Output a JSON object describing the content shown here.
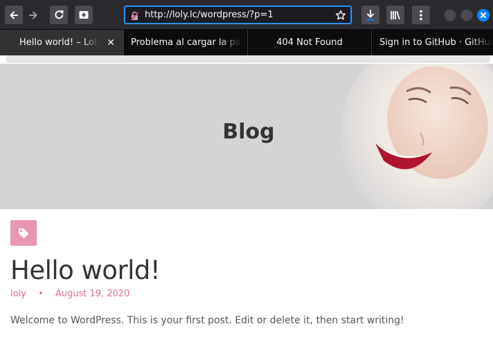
{
  "browser": {
    "url": "http://loly.lc/wordpress/?p=1",
    "tabs": [
      {
        "title": "Hello world! – Loly",
        "active": true
      },
      {
        "title": "Problema al cargar la página",
        "active": false
      },
      {
        "title": "404 Not Found",
        "active": false
      },
      {
        "title": "Sign in to GitHub · GitHub",
        "active": false
      }
    ],
    "icons": {
      "back": "arrow-left-icon",
      "forward": "arrow-right-icon",
      "reload": "reload-icon",
      "new_tab": "new-tab-icon",
      "lock": "insecure-lock-icon",
      "bookmark": "star-icon",
      "download": "download-icon",
      "library": "library-icon",
      "menu": "kebab-menu-icon",
      "close_tab": "close-icon"
    },
    "colors": {
      "chrome": "#2a2a2e",
      "url_focus": "#0a84ff",
      "window_close": "#0a84ff"
    }
  },
  "page": {
    "header_title": "Blog",
    "post": {
      "title": "Hello world!",
      "author": "loly",
      "separator": "•",
      "date": "August 19, 2020",
      "excerpt": "Welcome to WordPress. This is your first post. Edit or delete it, then start writing!"
    },
    "colors": {
      "accent": "#e896b4",
      "meta": "#e06c9a",
      "text": "#333333"
    }
  }
}
